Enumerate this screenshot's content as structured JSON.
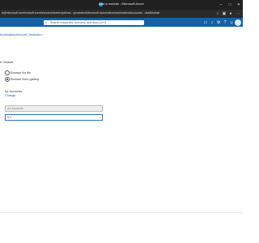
{
  "browser": {
    "title": "Add a module - Microsoft Azure",
    "url": "#@microsoft.onmicrosoft.com/resource/subscriptions/.../providers/Microsoft.Automation/automationAccounts/.../addModule",
    "icons": [
      "minimize-icon",
      "maximize-icon",
      "close-icon"
    ]
  },
  "portal": {
    "search_placeholder": "Search resources, services, and docs (G+/)"
  },
  "breadcrumb": "AutomationAccount | Modules >",
  "form": {
    "section_label": "e module",
    "options": [
      {
        "label": "Browse for file",
        "selected": false
      },
      {
        "label": "Browse from gallery",
        "selected": true
      }
    ],
    "gallery_label": "Az.Accounts",
    "change_link": "Change",
    "module_name_placeholder": "Az.Accounts",
    "runtime_value": "5.1"
  }
}
